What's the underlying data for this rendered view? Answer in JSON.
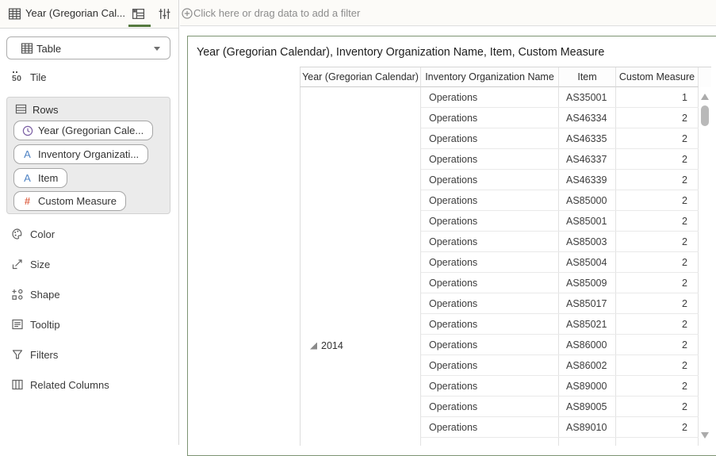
{
  "window": {
    "title": "Year (Gregorian Cal..."
  },
  "topbar": {
    "filter_placeholder": "Click here or drag data to add a filter"
  },
  "sidebar": {
    "viz_type_selector": "Table",
    "tile_label": "Tile",
    "rows_panel": {
      "label": "Rows",
      "pills": [
        {
          "type": "time",
          "label": "Year (Gregorian Cale..."
        },
        {
          "type": "attribute",
          "label": "Inventory Organizati..."
        },
        {
          "type": "attribute",
          "label": "Item"
        },
        {
          "type": "measure",
          "label": "Custom Measure"
        }
      ]
    },
    "items": [
      {
        "icon": "color",
        "label": "Color"
      },
      {
        "icon": "size",
        "label": "Size"
      },
      {
        "icon": "shape",
        "label": "Shape"
      },
      {
        "icon": "tooltip",
        "label": "Tooltip"
      },
      {
        "icon": "filters",
        "label": "Filters"
      },
      {
        "icon": "related-columns",
        "label": "Related Columns"
      }
    ]
  },
  "viz": {
    "title": "Year (Gregorian Calendar), Inventory Organization Name, Item, Custom Measure",
    "table": {
      "columns": [
        "Year (Gregorian Calendar)",
        "Inventory Organization Name",
        "Item",
        "Custom Measure"
      ],
      "year_group": "2014",
      "rows": [
        {
          "org": "Operations",
          "item": "AS35001",
          "value": "1"
        },
        {
          "org": "Operations",
          "item": "AS46334",
          "value": "2"
        },
        {
          "org": "Operations",
          "item": "AS46335",
          "value": "2"
        },
        {
          "org": "Operations",
          "item": "AS46337",
          "value": "2"
        },
        {
          "org": "Operations",
          "item": "AS46339",
          "value": "2"
        },
        {
          "org": "Operations",
          "item": "AS85000",
          "value": "2"
        },
        {
          "org": "Operations",
          "item": "AS85001",
          "value": "2"
        },
        {
          "org": "Operations",
          "item": "AS85003",
          "value": "2"
        },
        {
          "org": "Operations",
          "item": "AS85004",
          "value": "2"
        },
        {
          "org": "Operations",
          "item": "AS85009",
          "value": "2"
        },
        {
          "org": "Operations",
          "item": "AS85017",
          "value": "2"
        },
        {
          "org": "Operations",
          "item": "AS85021",
          "value": "2"
        },
        {
          "org": "Operations",
          "item": "AS86000",
          "value": "2"
        },
        {
          "org": "Operations",
          "item": "AS86002",
          "value": "2"
        },
        {
          "org": "Operations",
          "item": "AS89000",
          "value": "2"
        },
        {
          "org": "Operations",
          "item": "AS89005",
          "value": "2"
        },
        {
          "org": "Operations",
          "item": "AS89010",
          "value": "2"
        }
      ]
    }
  },
  "colors": {
    "accent_green": "#55793f",
    "selection_border": "#7d9473",
    "time_icon": "#7b5fa4",
    "attribute_icon": "#4f83c4",
    "measure_icon": "#df6a4f"
  }
}
